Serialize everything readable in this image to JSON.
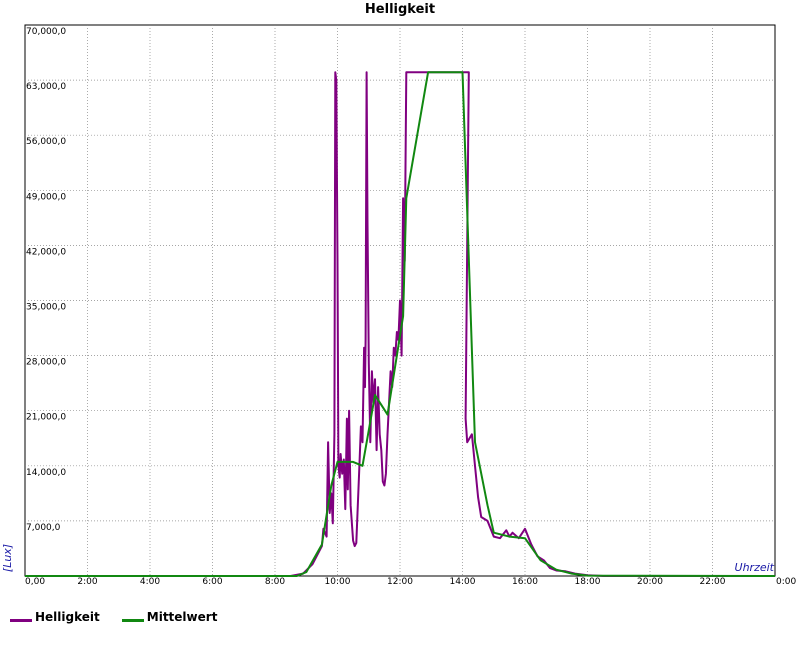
{
  "chart_data": {
    "type": "line",
    "title": "Helligkeit",
    "xlabel": "Uhrzeit",
    "ylabel": "[Lux]",
    "xlim": [
      0,
      24
    ],
    "ylim": [
      0,
      70000
    ],
    "x_ticks": [
      0,
      2,
      4,
      6,
      8,
      10,
      12,
      14,
      16,
      18,
      20,
      22,
      24
    ],
    "x_tick_labels": [
      "0,00",
      "2:00",
      "4:00",
      "6:00",
      "8:00",
      "10:00",
      "12:00",
      "14:00",
      "16:00",
      "18:00",
      "20:00",
      "22:00",
      "0:00"
    ],
    "y_ticks": [
      0,
      7000,
      14000,
      21000,
      28000,
      35000,
      42000,
      49000,
      56000,
      63000,
      70000
    ],
    "y_tick_labels": [
      "",
      "7,000,0",
      "14,000,0",
      "21,000,0",
      "28,000,0",
      "35,000,0",
      "42,000,0",
      "49,000,0",
      "56,000,0",
      "63,000,0",
      "70,000,0"
    ],
    "grid": true,
    "legend_position": "bottom-left",
    "series": [
      {
        "name": "Helligkeit",
        "color": "#800080",
        "points": [
          [
            0,
            0
          ],
          [
            8.5,
            0
          ],
          [
            8.9,
            300
          ],
          [
            9.2,
            1500
          ],
          [
            9.5,
            3800
          ],
          [
            9.55,
            6000
          ],
          [
            9.65,
            5000
          ],
          [
            9.7,
            17000
          ],
          [
            9.75,
            8000
          ],
          [
            9.8,
            10500
          ],
          [
            9.85,
            6700
          ],
          [
            9.9,
            18000
          ],
          [
            9.93,
            64000
          ],
          [
            9.96,
            63000
          ],
          [
            10.0,
            40000
          ],
          [
            10.03,
            14000
          ],
          [
            10.07,
            12500
          ],
          [
            10.1,
            15500
          ],
          [
            10.15,
            13000
          ],
          [
            10.2,
            14800
          ],
          [
            10.25,
            8500
          ],
          [
            10.3,
            20000
          ],
          [
            10.33,
            11000
          ],
          [
            10.37,
            21000
          ],
          [
            10.42,
            9000
          ],
          [
            10.5,
            4500
          ],
          [
            10.55,
            3800
          ],
          [
            10.6,
            4200
          ],
          [
            10.7,
            14000
          ],
          [
            10.75,
            19000
          ],
          [
            10.8,
            17000
          ],
          [
            10.85,
            29000
          ],
          [
            10.88,
            24000
          ],
          [
            10.9,
            30000
          ],
          [
            10.93,
            64000
          ],
          [
            10.96,
            45000
          ],
          [
            11.0,
            27000
          ],
          [
            11.05,
            17000
          ],
          [
            11.1,
            26000
          ],
          [
            11.15,
            22000
          ],
          [
            11.2,
            25000
          ],
          [
            11.25,
            16000
          ],
          [
            11.3,
            24000
          ],
          [
            11.35,
            18000
          ],
          [
            11.4,
            16000
          ],
          [
            11.45,
            12000
          ],
          [
            11.5,
            11500
          ],
          [
            11.55,
            13000
          ],
          [
            11.6,
            18000
          ],
          [
            11.7,
            26000
          ],
          [
            11.75,
            24000
          ],
          [
            11.8,
            29000
          ],
          [
            11.85,
            28000
          ],
          [
            11.9,
            31000
          ],
          [
            11.95,
            30000
          ],
          [
            12.0,
            35000
          ],
          [
            12.05,
            28000
          ],
          [
            12.1,
            48000
          ],
          [
            12.15,
            40000
          ],
          [
            12.2,
            64000
          ],
          [
            14.1,
            64000
          ],
          [
            14.2,
            64000
          ],
          [
            14.1,
            20000
          ],
          [
            14.15,
            17000
          ],
          [
            14.3,
            18000
          ],
          [
            14.4,
            14000
          ],
          [
            14.5,
            10000
          ],
          [
            14.6,
            7500
          ],
          [
            14.8,
            7000
          ],
          [
            15.0,
            5000
          ],
          [
            15.2,
            4800
          ],
          [
            15.4,
            5800
          ],
          [
            15.5,
            5000
          ],
          [
            15.6,
            5500
          ],
          [
            15.8,
            4800
          ],
          [
            16.0,
            6000
          ],
          [
            16.2,
            4000
          ],
          [
            16.4,
            2500
          ],
          [
            16.6,
            2000
          ],
          [
            16.8,
            1000
          ],
          [
            17.0,
            700
          ],
          [
            17.3,
            600
          ],
          [
            17.6,
            300
          ],
          [
            18.0,
            100
          ],
          [
            18.5,
            0
          ],
          [
            24,
            0
          ]
        ]
      },
      {
        "name": "Mittelwert",
        "color": "#118811",
        "points": [
          [
            0,
            0
          ],
          [
            8.7,
            0
          ],
          [
            9.0,
            500
          ],
          [
            9.5,
            4000
          ],
          [
            9.8,
            11500
          ],
          [
            10.0,
            14500
          ],
          [
            10.5,
            14500
          ],
          [
            10.8,
            14000
          ],
          [
            11.2,
            23000
          ],
          [
            11.6,
            20500
          ],
          [
            12.1,
            33000
          ],
          [
            12.2,
            48000
          ],
          [
            12.9,
            64000
          ],
          [
            14.0,
            64000
          ],
          [
            14.4,
            17000
          ],
          [
            14.8,
            9000
          ],
          [
            15.0,
            5500
          ],
          [
            15.5,
            5000
          ],
          [
            16.0,
            4800
          ],
          [
            16.5,
            2000
          ],
          [
            17.0,
            800
          ],
          [
            17.5,
            300
          ],
          [
            18.0,
            50
          ],
          [
            24,
            0
          ]
        ]
      }
    ]
  }
}
